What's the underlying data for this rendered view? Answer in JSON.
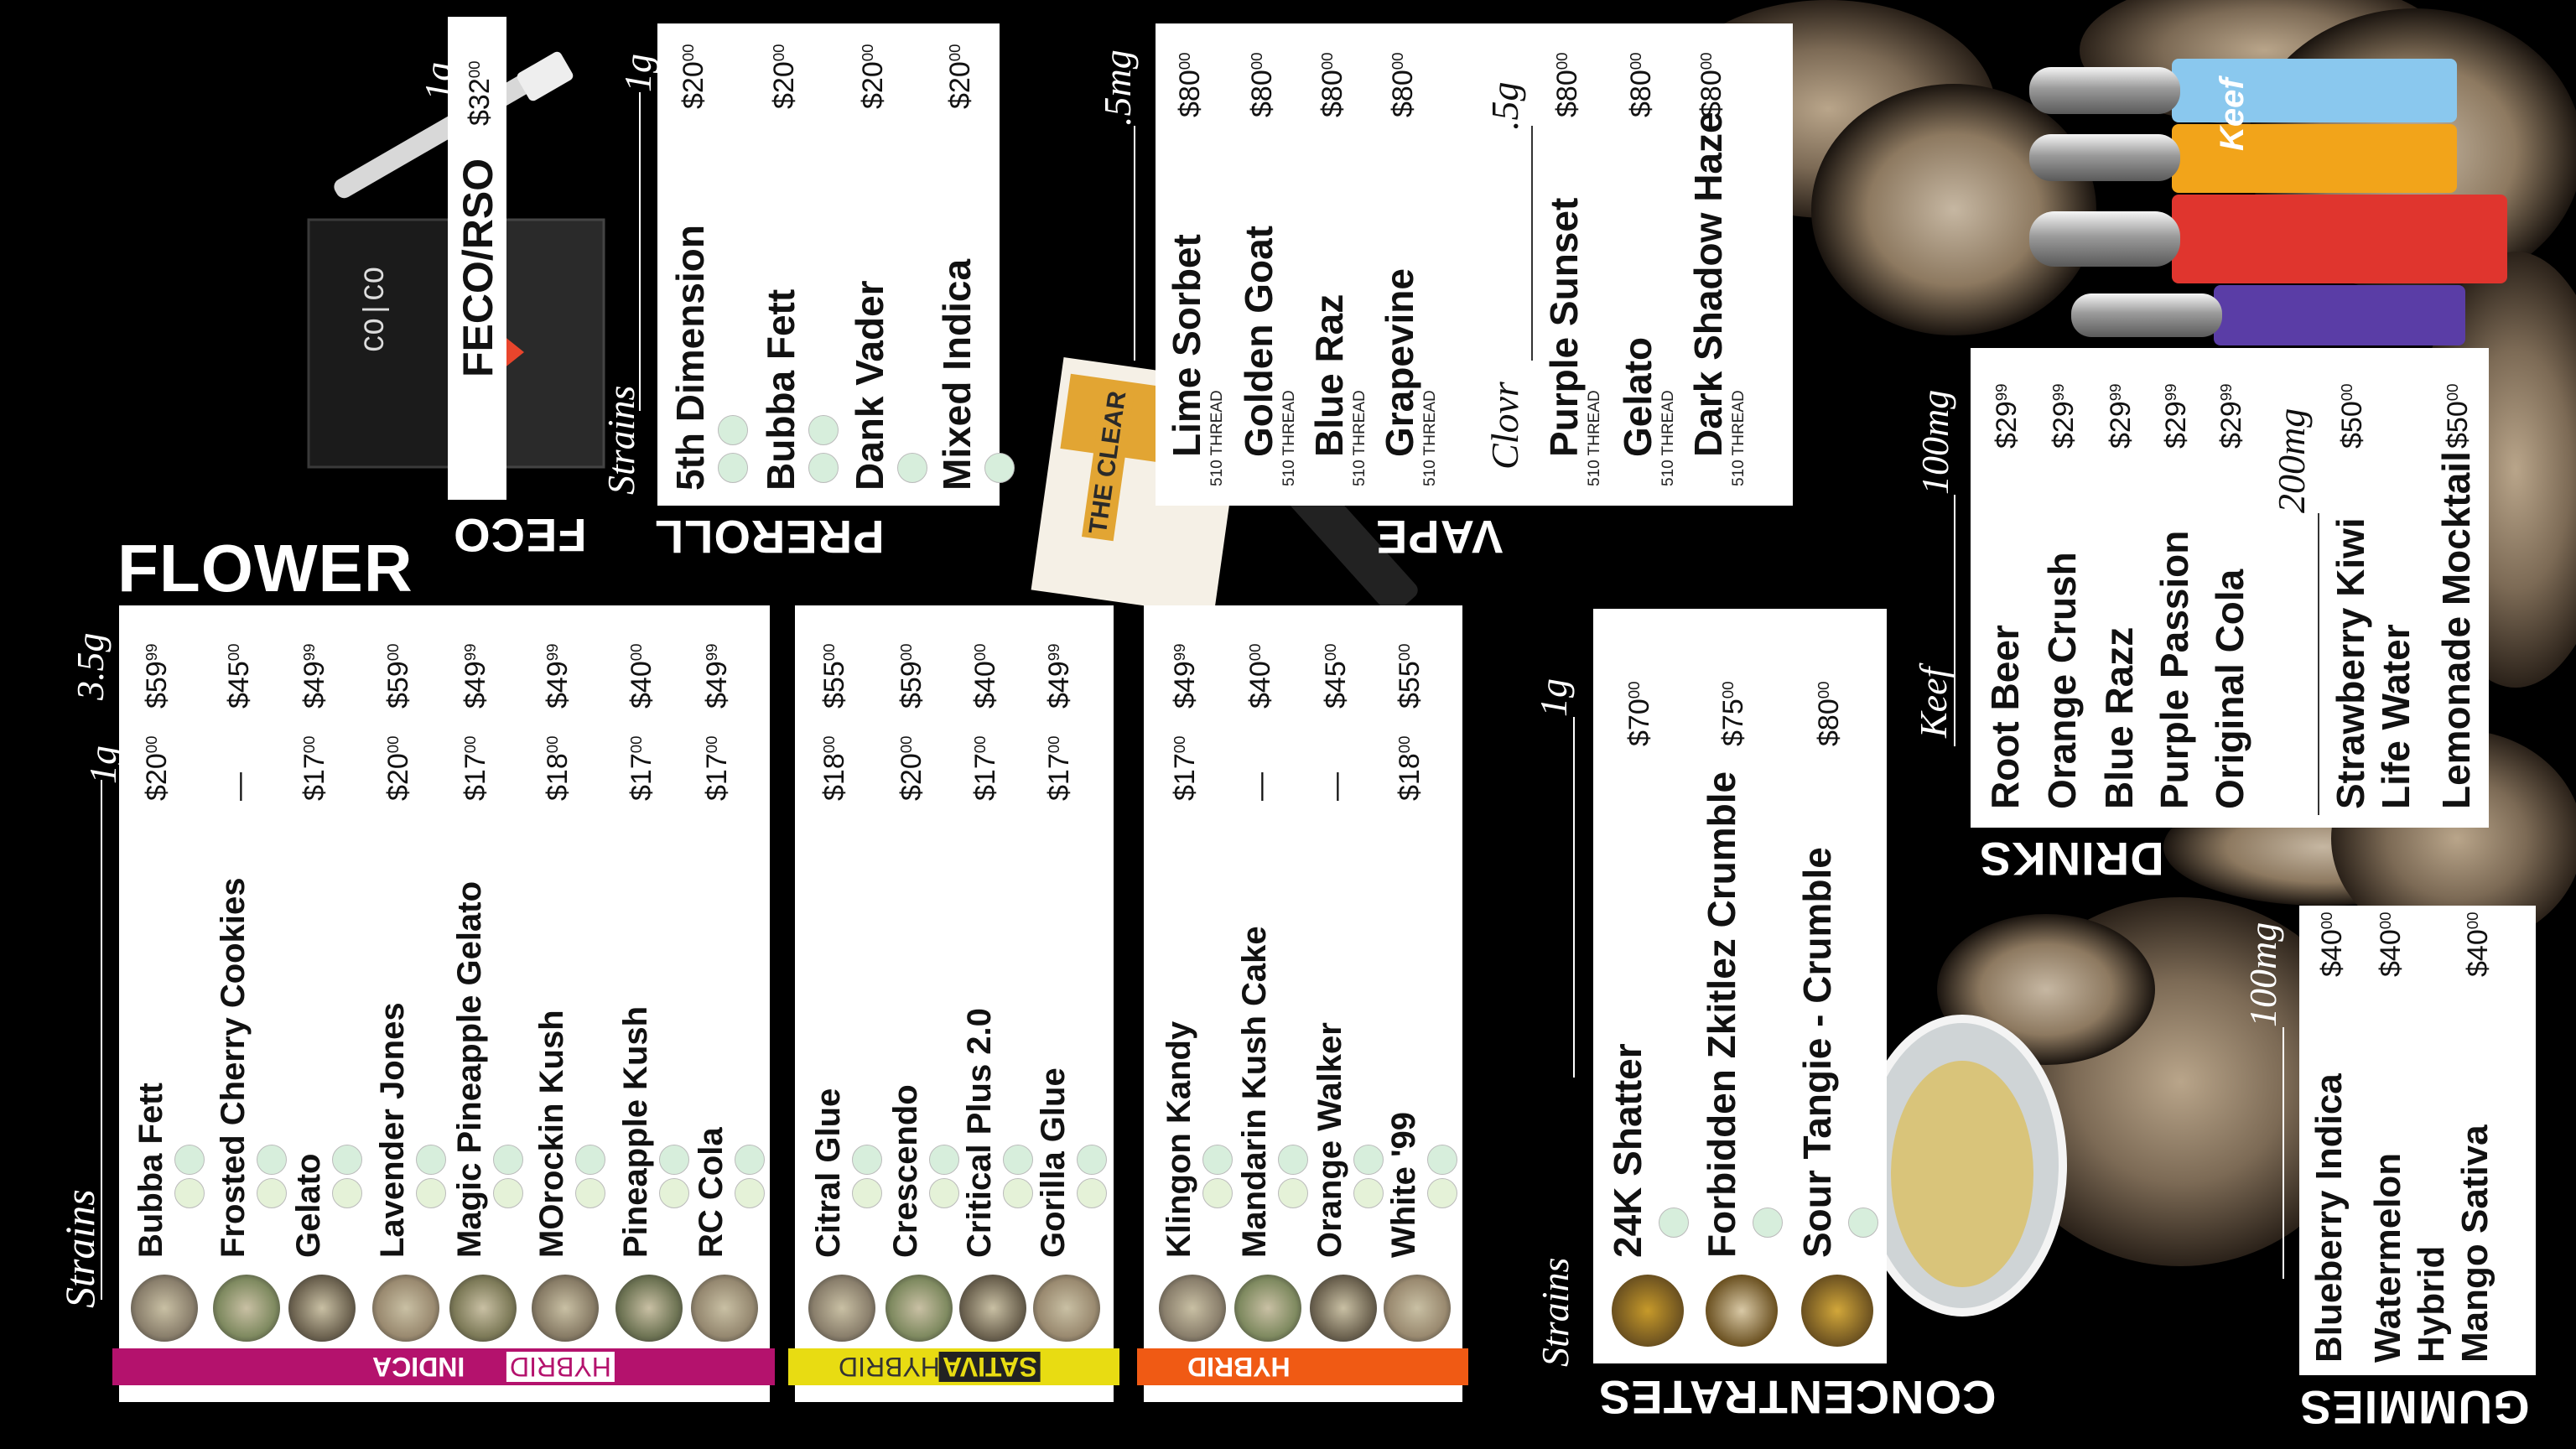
{
  "flower": {
    "title": "FLOWER",
    "strains_label": "Strains",
    "size_1g": "1g",
    "size_35g": "3.5g",
    "indica_items": [
      {
        "name": "Bubba Fett",
        "p1": "$20",
        "p1c": "00",
        "p2": "$59",
        "p2c": "99"
      },
      {
        "name": "Frosted Cherry Cookies",
        "p1": "—",
        "p1c": "",
        "p2": "$45",
        "p2c": "00"
      },
      {
        "name": "Gelato",
        "p1": "$17",
        "p1c": "00",
        "p2": "$49",
        "p2c": "99"
      },
      {
        "name": "Lavender Jones",
        "p1": "$20",
        "p1c": "00",
        "p2": "$59",
        "p2c": "00"
      },
      {
        "name": "Magic Pineapple Gelato",
        "p1": "$17",
        "p1c": "00",
        "p2": "$49",
        "p2c": "99"
      },
      {
        "name": "MOrockin Kush",
        "p1": "$18",
        "p1c": "00",
        "p2": "$49",
        "p2c": "99"
      },
      {
        "name": "Pineapple Kush",
        "p1": "$17",
        "p1c": "00",
        "p2": "$40",
        "p2c": "00"
      },
      {
        "name": "RC Cola",
        "p1": "$17",
        "p1c": "00",
        "p2": "$49",
        "p2c": "99"
      }
    ],
    "sativa_items": [
      {
        "name": "Citral Glue",
        "p1": "$18",
        "p1c": "00",
        "p2": "$55",
        "p2c": "00"
      },
      {
        "name": "Crescendo",
        "p1": "$20",
        "p1c": "00",
        "p2": "$59",
        "p2c": "00"
      },
      {
        "name": "Critical Plus 2.0",
        "p1": "$17",
        "p1c": "00",
        "p2": "$40",
        "p2c": "00"
      },
      {
        "name": "Gorilla Glue",
        "p1": "$17",
        "p1c": "00",
        "p2": "$49",
        "p2c": "99"
      }
    ],
    "hybrid_items": [
      {
        "name": "Klingon Kandy",
        "p1": "$17",
        "p1c": "00",
        "p2": "$49",
        "p2c": "99"
      },
      {
        "name": "Mandarin Kush Cake",
        "p1": "—",
        "p1c": "",
        "p2": "$40",
        "p2c": "00"
      },
      {
        "name": "Orange Walker",
        "p1": "—",
        "p1c": "",
        "p2": "$45",
        "p2c": "00"
      },
      {
        "name": "White '99",
        "p1": "$18",
        "p1c": "00",
        "p2": "$55",
        "p2c": "00"
      }
    ],
    "indica_tag": "INDICA",
    "indica_sub": "HYBRID",
    "sativa_tag": "SATIVA",
    "sativa_sub": "HYBRID",
    "hybrid_tag": "HYBRID",
    "colors": {
      "indica": "#b4126d",
      "sativa": "#e8dc12",
      "hybrid": "#f05a14"
    }
  },
  "feco": {
    "title": "FECO",
    "size": "1g",
    "item": "FECO/RSO",
    "price": "$32",
    "cents": "00",
    "package_label": "CO|CO"
  },
  "preroll": {
    "title": "PREROLL",
    "strains_label": "Strains",
    "size": "1g",
    "items": [
      {
        "name": "5th Dimension",
        "price": "$20",
        "cents": "00"
      },
      {
        "name": "Bubba Fett",
        "price": "$20",
        "cents": "00"
      },
      {
        "name": "Dank Vader",
        "price": "$20",
        "cents": "00"
      },
      {
        "name": "Mixed Indica",
        "price": "$20",
        "cents": "00"
      }
    ]
  },
  "vape": {
    "title": "VAPE",
    "size_half": ".5mg",
    "size_5g": ".5g",
    "brand_label": "Clovr",
    "items": [
      {
        "name": "Lime Sorbet",
        "sub": "510 THREAD",
        "price": "$80",
        "cents": "00"
      },
      {
        "name": "Golden Goat",
        "sub": "510 THREAD",
        "price": "$80",
        "cents": "00"
      },
      {
        "name": "Blue Raz",
        "sub": "510 THREAD",
        "price": "$80",
        "cents": "00"
      },
      {
        "name": "Grapevine",
        "sub": "510 THREAD",
        "price": "$80",
        "cents": "00"
      }
    ],
    "clovr_items": [
      {
        "name": "Purple Sunset",
        "sub": "510 THREAD",
        "price": "$80",
        "cents": "00"
      },
      {
        "name": "Gelato",
        "sub": "510 THREAD",
        "price": "$80",
        "cents": "00"
      },
      {
        "name": "Dark Shadow Haze",
        "sub": "510 THREAD",
        "price": "$80",
        "cents": "00"
      }
    ],
    "cartridge_label": "THE CLEAR"
  },
  "concentrates": {
    "title": "CONCENTRATES",
    "strains_label": "Strains",
    "size": "1g",
    "items": [
      {
        "name": "24K Shatter",
        "price": "$70",
        "cents": "00"
      },
      {
        "name": "Forbidden Zkitlez Crumble",
        "price": "$75",
        "cents": "00"
      },
      {
        "name": "Sour Tangie - Crumble",
        "price": "$80",
        "cents": "00"
      }
    ]
  },
  "drinks": {
    "title": "DRINKS",
    "brand_label": "Keef",
    "size_100": "100mg",
    "size_200": "200mg",
    "items": [
      {
        "name": "Root Beer",
        "price": "$29",
        "cents": "99"
      },
      {
        "name": "Orange Crush",
        "price": "$29",
        "cents": "99"
      },
      {
        "name": "Blue Razz",
        "price": "$29",
        "cents": "99"
      },
      {
        "name": "Purple Passion",
        "price": "$29",
        "cents": "99"
      },
      {
        "name": "Original Cola",
        "price": "$29",
        "cents": "99"
      }
    ],
    "items_200": [
      {
        "name": "Strawberry Kiwi",
        "name2": "Life Water",
        "price": "$50",
        "cents": "00"
      },
      {
        "name": "Lemonade Mocktail",
        "name2": "",
        "price": "$50",
        "cents": "00"
      }
    ],
    "bottle_brand": "Keef"
  },
  "gummies": {
    "title": "GUMMIES",
    "size": "100mg",
    "items": [
      {
        "name": "Blueberry Indica",
        "name2": "",
        "price": "$40",
        "cents": "00"
      },
      {
        "name": "Watermelon",
        "name2": "Hybrid",
        "price": "$40",
        "cents": "00"
      },
      {
        "name": "Mango Sativa",
        "name2": "",
        "price": "$40",
        "cents": "00"
      }
    ]
  }
}
